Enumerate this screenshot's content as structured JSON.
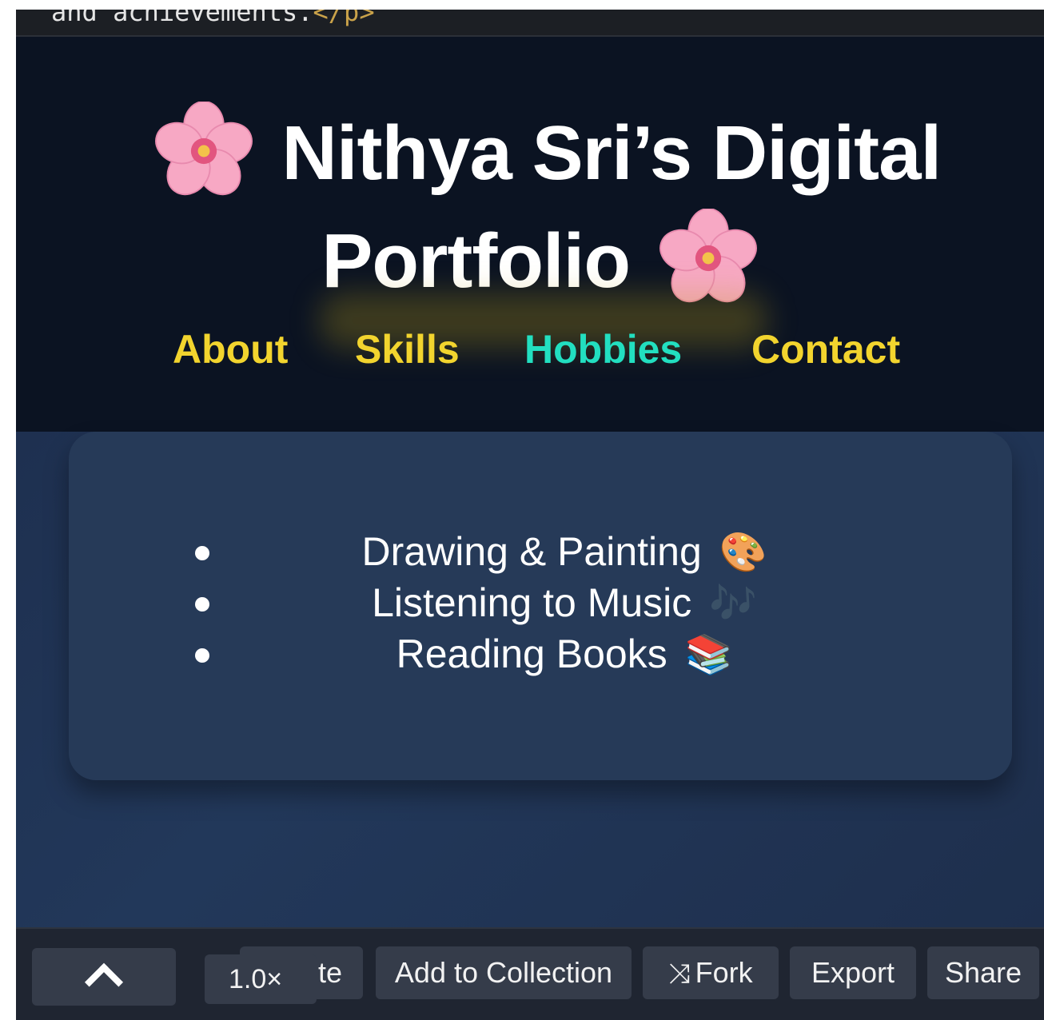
{
  "code_strip": {
    "text": "and achievements.",
    "tag": "</p>"
  },
  "header": {
    "title_line1": "Nithya Sri’s Digital",
    "title_line2": "Portfolio",
    "icon": "cherry-blossom-icon"
  },
  "nav": {
    "items": [
      {
        "label": "About",
        "active": false
      },
      {
        "label": "Skills",
        "active": false
      },
      {
        "label": "Hobbies",
        "active": true
      },
      {
        "label": "Contact",
        "active": false
      }
    ],
    "color": "#f2d42e",
    "active_color": "#22dfc0"
  },
  "hobbies": {
    "items": [
      {
        "label": "Drawing & Painting",
        "emoji": "🎨"
      },
      {
        "label": "Listening to Music",
        "emoji": "🎶"
      },
      {
        "label": "Reading Books",
        "emoji": "📚"
      }
    ]
  },
  "toolbar": {
    "zoom": "1.0×",
    "partial_label": "te",
    "add_collection": "Add to Collection",
    "fork": "Fork",
    "export": "Export",
    "share": "Share",
    "icons": [
      "chevron-up-icon",
      "fork-icon"
    ]
  },
  "colors": {
    "hero_bg": "#0b1322",
    "content_bg": "#1e3050",
    "card_bg": "#263a58",
    "toolbar_bg": "#1f2531"
  }
}
